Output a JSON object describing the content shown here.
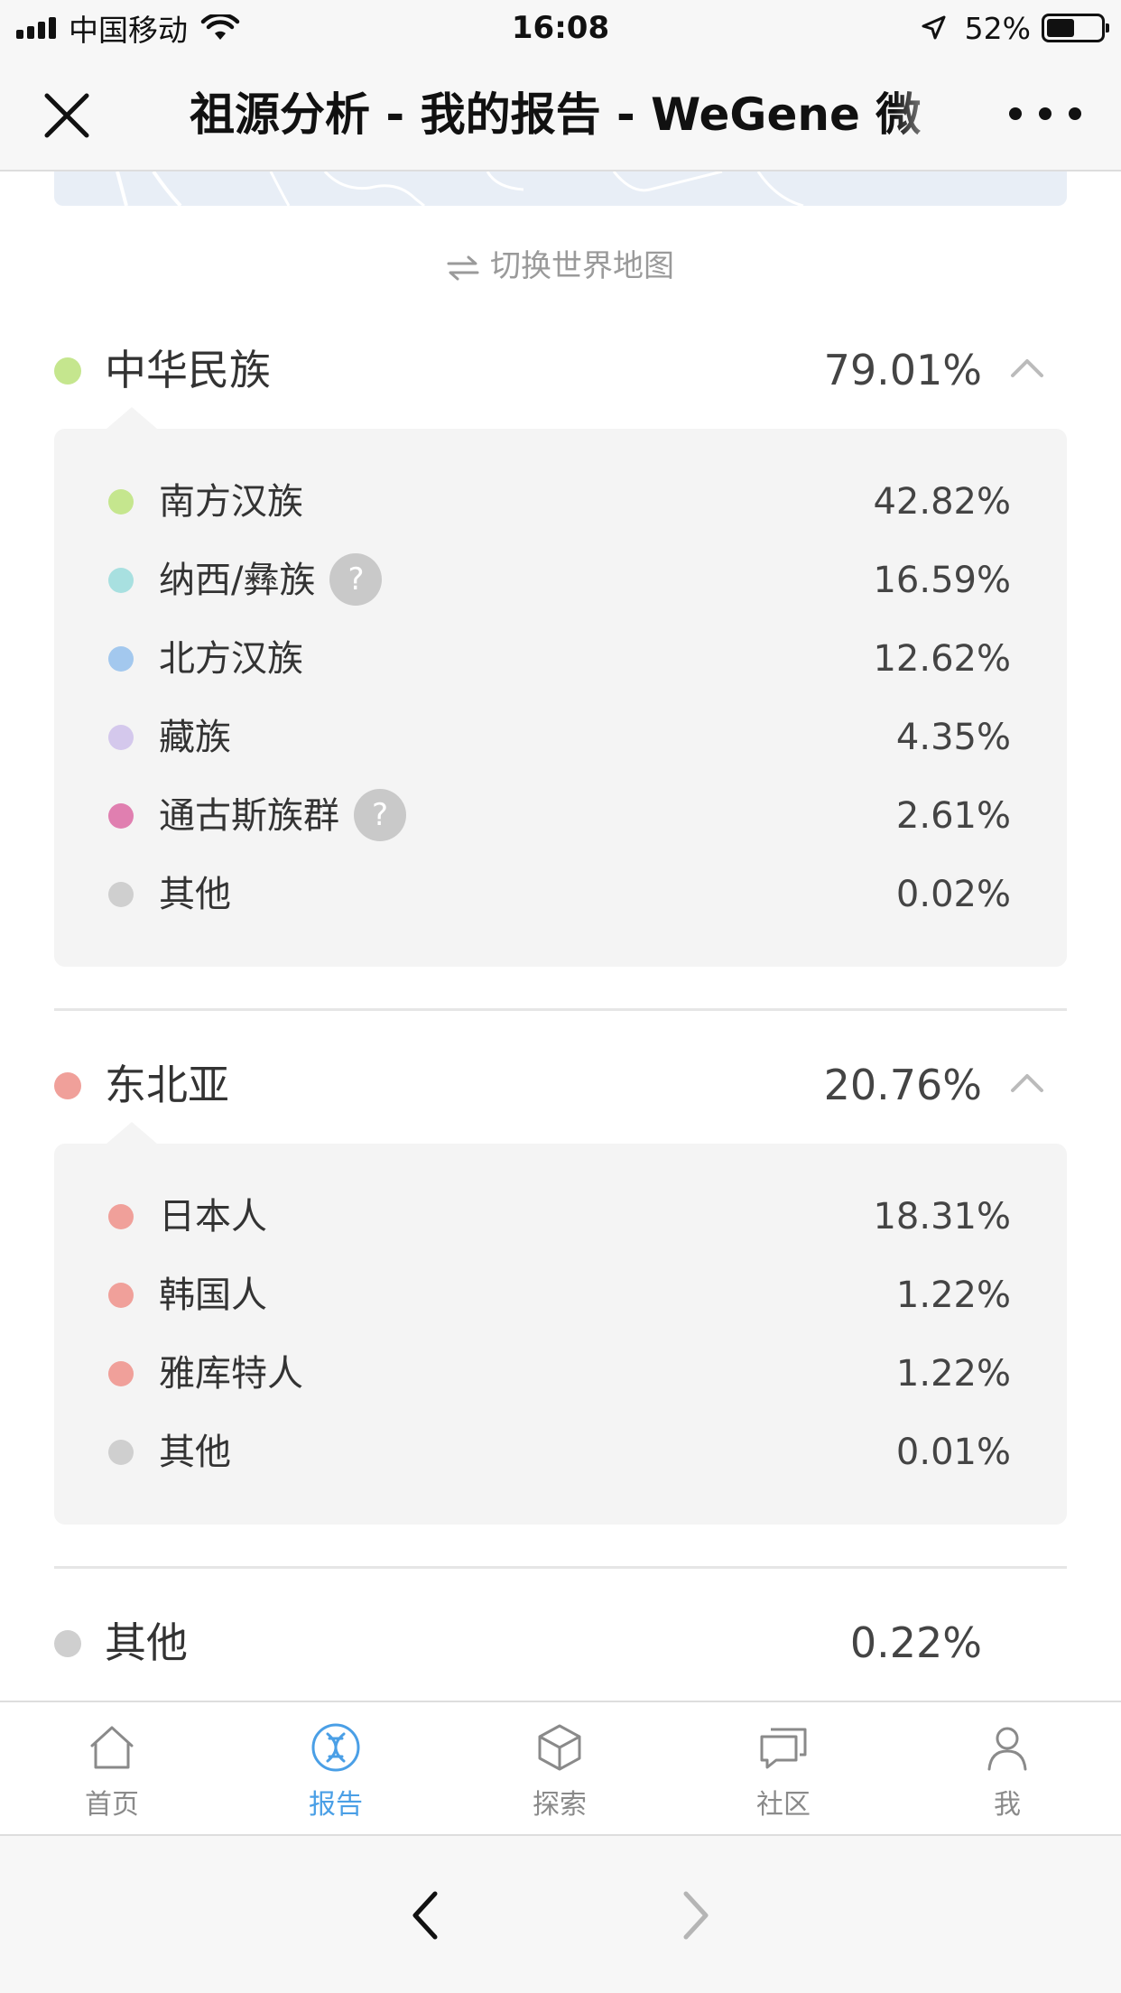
{
  "status_bar": {
    "carrier": "中国移动",
    "time": "16:08",
    "battery_percent": "52%",
    "battery_level": 0.52
  },
  "nav": {
    "title": "祖源分析 - 我的报告 - WeGene 微"
  },
  "switch_map": {
    "label": "切换世界地图",
    "icon": "swap-arrows-icon"
  },
  "groups": [
    {
      "name": "中华民族",
      "percent": "79.01%",
      "color": "#c5e68e",
      "items": [
        {
          "name": "南方汉族",
          "percent": "42.82%",
          "color": "#c5e68e",
          "help": false
        },
        {
          "name": "纳西/彝族",
          "percent": "16.59%",
          "color": "#a8e0e0",
          "help": true
        },
        {
          "name": "北方汉族",
          "percent": "12.62%",
          "color": "#a3c8ee",
          "help": false
        },
        {
          "name": "藏族",
          "percent": "4.35%",
          "color": "#d4c8ec",
          "help": false
        },
        {
          "name": "通古斯族群",
          "percent": "2.61%",
          "color": "#e07fb0",
          "help": true
        },
        {
          "name": "其他",
          "percent": "0.02%",
          "color": "#cfcfcf",
          "help": false
        }
      ]
    },
    {
      "name": "东北亚",
      "percent": "20.76%",
      "color": "#f0a09a",
      "items": [
        {
          "name": "日本人",
          "percent": "18.31%",
          "color": "#f0a09a",
          "help": false
        },
        {
          "name": "韩国人",
          "percent": "1.22%",
          "color": "#f0a09a",
          "help": false
        },
        {
          "name": "雅库特人",
          "percent": "1.22%",
          "color": "#f0a09a",
          "help": false
        },
        {
          "name": "其他",
          "percent": "0.01%",
          "color": "#cfcfcf",
          "help": false
        }
      ]
    },
    {
      "name": "其他",
      "percent": "0.22%",
      "color": "#cfcfcf",
      "items": []
    }
  ],
  "help_symbol": "?",
  "tabbar": {
    "tabs": [
      {
        "label": "首页",
        "icon": "home-icon",
        "active": false
      },
      {
        "label": "报告",
        "icon": "dna-icon",
        "active": true
      },
      {
        "label": "探索",
        "icon": "cube-icon",
        "active": false
      },
      {
        "label": "社区",
        "icon": "chat-icon",
        "active": false
      },
      {
        "label": "我",
        "icon": "user-icon",
        "active": false
      }
    ],
    "active_color": "#4a9fe6",
    "inactive_color": "#8a8a8a"
  }
}
